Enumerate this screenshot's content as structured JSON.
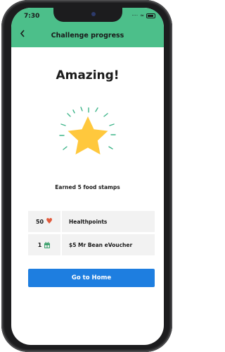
{
  "status_bar": {
    "time": "7:30",
    "signal": "····",
    "wifi": "≈"
  },
  "header": {
    "back_icon": "chevron-left-icon",
    "title": "Challenge progress"
  },
  "main": {
    "headline": "Amazing!",
    "star_icon": "star-icon",
    "earned_text": "Earned 5 food stamps"
  },
  "rewards": [
    {
      "qty": "50",
      "icon": "heart-icon",
      "label": "Healthpoints"
    },
    {
      "qty": "1",
      "icon": "gift-icon",
      "label": "$5 Mr Bean eVoucher"
    }
  ],
  "actions": {
    "home_label": "Go to Home"
  },
  "colors": {
    "header": "#4cbf8a",
    "star": "#ffc83d",
    "rays": "#3fb58a",
    "button": "#1e7ee0",
    "heart": "#e25a3c",
    "gift": "#2f9a63"
  }
}
